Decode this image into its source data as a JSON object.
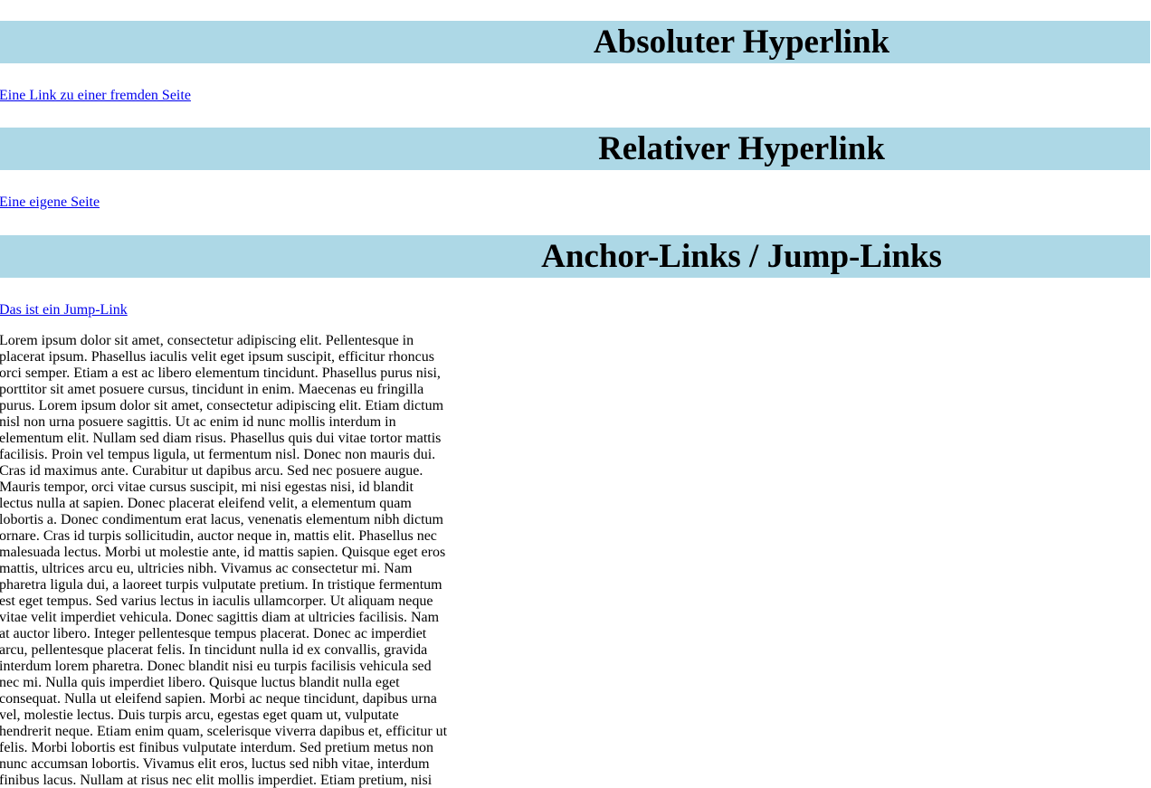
{
  "sections": {
    "absolute": {
      "heading": "Absoluter Hyperlink",
      "link_text": "Eine Link zu einer fremden Seite"
    },
    "relative": {
      "heading": "Relativer Hyperlink",
      "link_text": "Eine eigene Seite"
    },
    "anchor": {
      "heading": "Anchor-Links / Jump-Links",
      "link_text": "Das ist ein Jump-Link",
      "body_text": "Lorem ipsum dolor sit amet, consectetur adipiscing elit. Pellentesque in placerat ipsum. Phasellus iaculis velit eget ipsum suscipit, efficitur rhoncus orci semper. Etiam a est ac libero elementum tincidunt. Phasellus purus nisi, porttitor sit amet posuere cursus, tincidunt in enim. Maecenas eu fringilla purus. Lorem ipsum dolor sit amet, consectetur adipiscing elit. Etiam dictum nisl non urna posuere sagittis. Ut ac enim id nunc mollis interdum in elementum elit. Nullam sed diam risus. Phasellus quis dui vitae tortor mattis facilisis. Proin vel tempus ligula, ut fermentum nisl. Donec non mauris dui. Cras id maximus ante. Curabitur ut dapibus arcu. Sed nec posuere augue. Mauris tempor, orci vitae cursus suscipit, mi nisi egestas nisi, id blandit lectus nulla at sapien. Donec placerat eleifend velit, a elementum quam lobortis a. Donec condimentum erat lacus, venenatis elementum nibh dictum ornare. Cras id turpis sollicitudin, auctor neque in, mattis elit. Phasellus nec malesuada lectus. Morbi ut molestie ante, id mattis sapien. Quisque eget eros mattis, ultrices arcu eu, ultricies nibh. Vivamus ac consectetur mi. Nam pharetra ligula dui, a laoreet turpis vulputate pretium. In tristique fermentum est eget tempus. Sed varius lectus in iaculis ullamcorper. Ut aliquam neque vitae velit imperdiet vehicula. Donec sagittis diam at ultricies facilisis. Nam at auctor libero. Integer pellentesque tempus placerat. Donec ac imperdiet arcu, pellentesque placerat felis. In tincidunt nulla id ex convallis, gravida interdum lorem pharetra. Donec blandit nisi eu turpis facilisis vehicula sed nec mi. Nulla quis imperdiet libero. Quisque luctus blandit nulla eget consequat. Nulla ut eleifend sapien. Morbi ac neque tincidunt, dapibus urna vel, molestie lectus. Duis turpis arcu, egestas eget quam ut, vulputate hendrerit neque. Etiam enim quam, scelerisque viverra dapibus et, efficitur ut felis. Morbi lobortis est finibus vulputate interdum. Sed pretium metus non nunc accumsan lobortis. Vivamus elit eros, luctus sed nibh vitae, interdum finibus lacus. Nullam at risus nec elit mollis imperdiet. Etiam pretium, nisi"
    }
  },
  "colors": {
    "heading_background": "#add8e6",
    "link": "#0000ee",
    "text": "#000000",
    "page_background": "#ffffff"
  }
}
